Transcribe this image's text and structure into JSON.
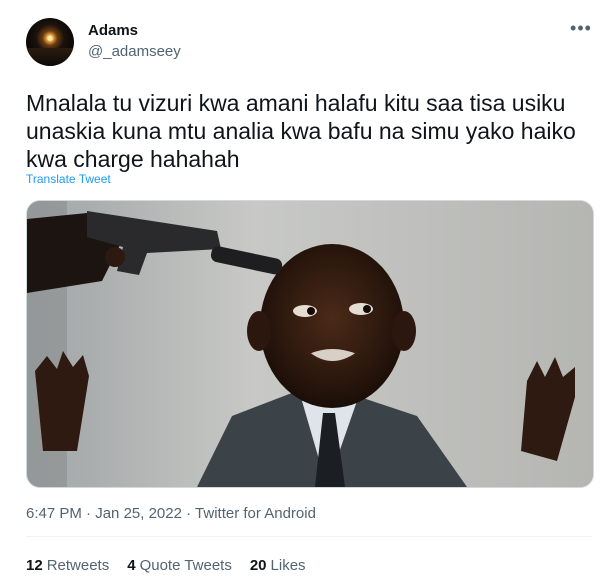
{
  "user": {
    "name": "Adams",
    "handle": "@_adamseey"
  },
  "more_icon": "more-horizontal-icon",
  "tweet": {
    "text": "Mnalala tu vizuri kwa amani halafu kitu saa tisa usiku\nunaskia kuna mtu analia kwa bafu na simu yako haiko\nkwa charge hahahah",
    "translate_label": "Translate Tweet"
  },
  "meta": {
    "time": "6:47 PM",
    "date": "Jan 25, 2022",
    "source": "Twitter for Android",
    "separator": "·"
  },
  "stats": {
    "retweets_count": "12",
    "retweets_label": "Retweets",
    "quote_count": "4",
    "quote_label": "Quote Tweets",
    "likes_count": "20",
    "likes_label": "Likes"
  },
  "colors": {
    "text": "#0f1419",
    "secondary": "#536471",
    "link": "#1d9bf0",
    "border": "#eff3f4"
  }
}
